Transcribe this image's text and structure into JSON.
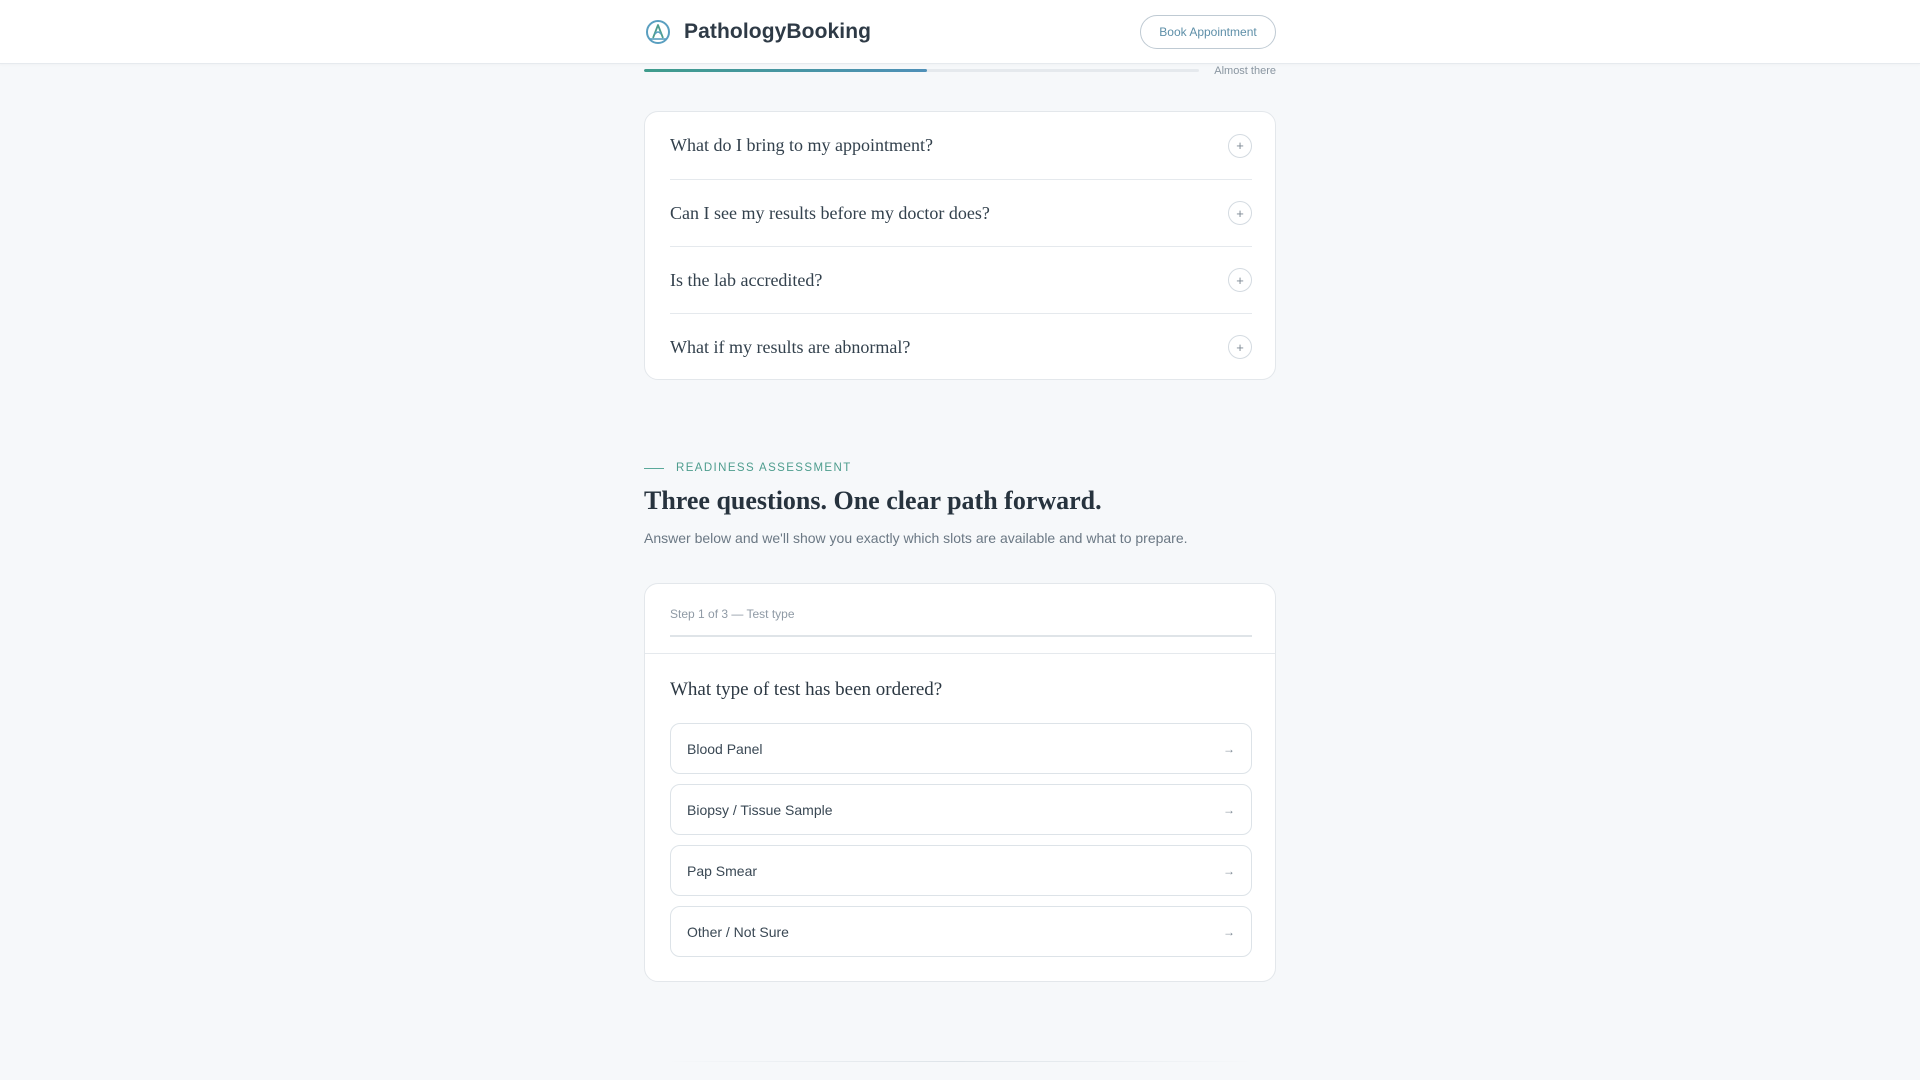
{
  "header": {
    "brand_name": "PathologyBooking",
    "logo_icon": "microscope-logo-icon",
    "book_button_label": "Book Appointment"
  },
  "progress": {
    "fraction": 0.51,
    "label": "Almost there"
  },
  "faq": {
    "items": [
      {
        "question": "What do I bring to my appointment?",
        "toggle": "+"
      },
      {
        "question": "Can I see my results before my doctor does?",
        "toggle": "+"
      },
      {
        "question": "Is the lab accredited?",
        "toggle": "+"
      },
      {
        "question": "What if my results are abnormal?",
        "toggle": "+"
      }
    ]
  },
  "readiness": {
    "eyebrow": "READINESS ASSESSMENT",
    "title": "Three questions. One clear path forward.",
    "subtitle": "Answer below and we'll show you exactly which slots are available and what to prepare."
  },
  "assessment": {
    "step_label": "Step 1 of 3 — Test type",
    "question": "What type of test has been ordered?",
    "options": [
      {
        "label": "Blood Panel",
        "arrow": "→"
      },
      {
        "label": "Biopsy / Tissue Sample",
        "arrow": "→"
      },
      {
        "label": "Pap Smear",
        "arrow": "→"
      },
      {
        "label": "Other / Not Sure",
        "arrow": "→"
      }
    ]
  },
  "colors": {
    "accent_teal": "#4e9d8e",
    "accent_blue": "#4f90b8",
    "background": "#f6f8fa"
  }
}
